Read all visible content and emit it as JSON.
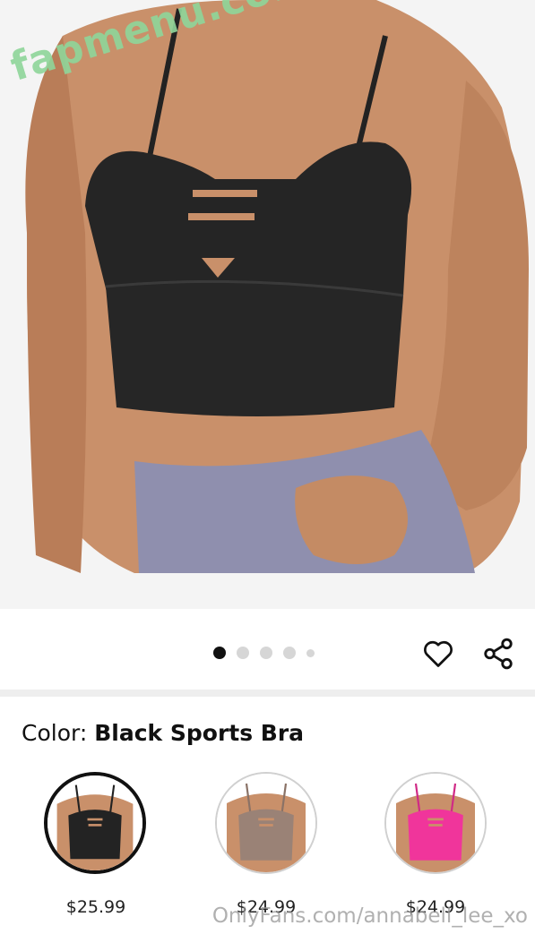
{
  "product_image": {
    "alt": "product-photo",
    "watermark": "fapmenu.com"
  },
  "carousel": {
    "total": 5,
    "active_index": 0
  },
  "actions": {
    "favorite_icon": "heart-icon",
    "share_icon": "share-icon"
  },
  "color_selector": {
    "label": "Color:",
    "selected_value": "Black Sports Bra",
    "options": [
      {
        "color": "#232323",
        "price": "$25.99"
      },
      {
        "color": "#9a8276",
        "price": "$24.99"
      },
      {
        "color": "#f0359b",
        "price": "$24.99"
      }
    ]
  },
  "footer_watermark": "OnlyFans.com/annabell_lee_xo",
  "colors": {
    "background": "#ffffff",
    "image_background": "#f4f4f4",
    "separator": "#eeeeee",
    "dot_active": "#111111",
    "dot_inactive": "#d6d6d6",
    "watermark_green": "#8fd69a"
  }
}
